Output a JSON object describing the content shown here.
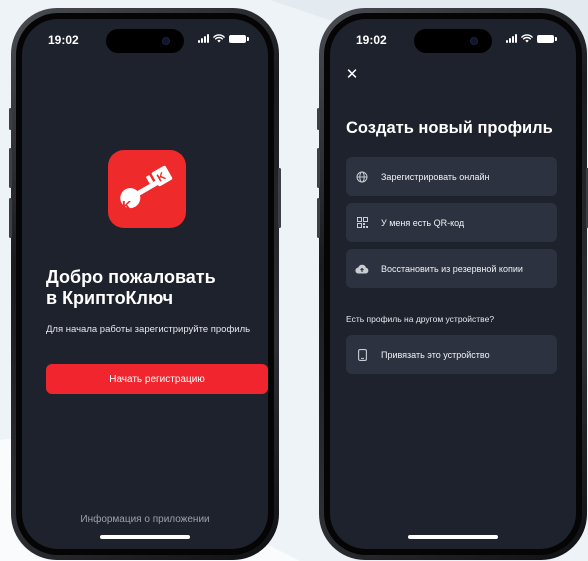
{
  "status_bar": {
    "time": "19:02"
  },
  "welcome_screen": {
    "title_line1": "Добро пожаловать",
    "title_line2": "в КриптоКлюч",
    "subtitle": "Для начала работы зарегистрируйте профиль",
    "start_button_label": "Начать регистрацию",
    "info_link_label": "Информация о приложении",
    "logo_letter": "K"
  },
  "create_profile_screen": {
    "close_label": "✕",
    "title": "Создать новый профиль",
    "options": [
      {
        "label": "Зарегистрировать онлайн",
        "icon": "globe-icon"
      },
      {
        "label": "У меня есть QR-код",
        "icon": "qr-code-icon"
      },
      {
        "label": "Восстановить из резервной копии",
        "icon": "cloud-upload-icon"
      }
    ],
    "other_device_label": "Есть профиль на другом устройстве?",
    "link_device_option": {
      "label": "Привязать это устройство",
      "icon": "smartphone-icon"
    }
  },
  "colors": {
    "accent_red": "#f0252d",
    "screen_bg": "#1e222c",
    "card_bg": "#2c3240"
  }
}
